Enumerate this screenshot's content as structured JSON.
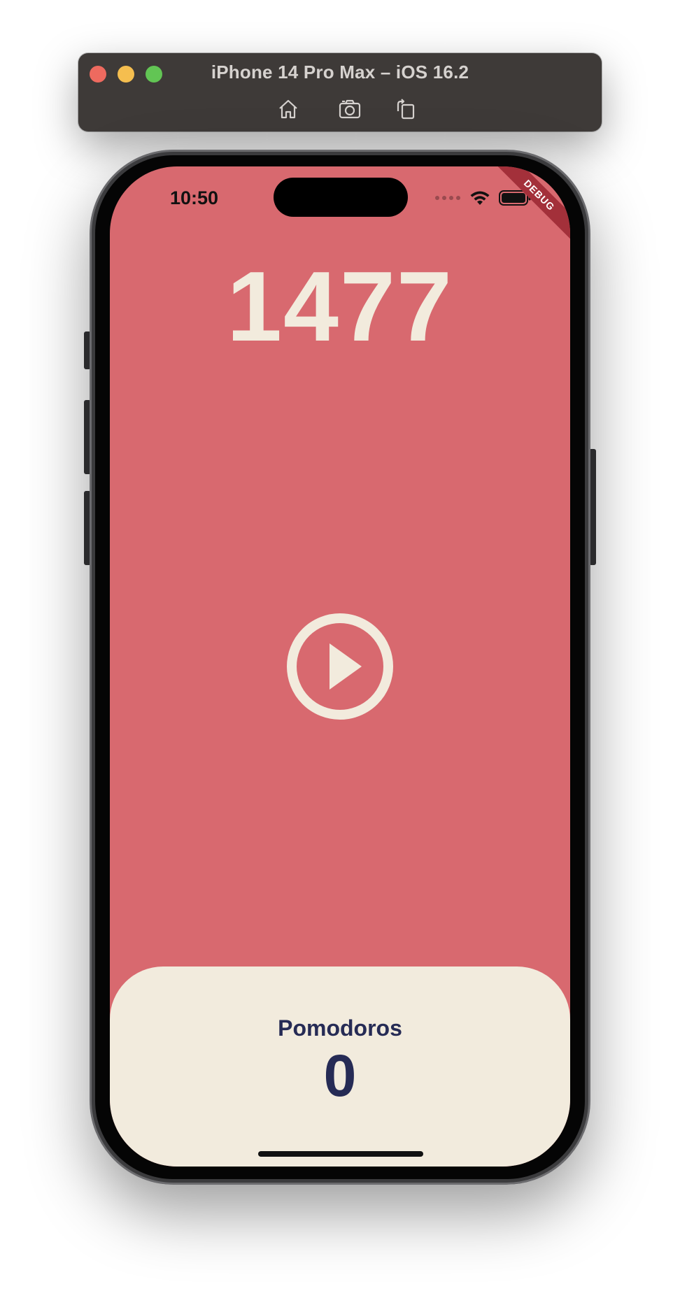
{
  "simulator": {
    "title": "iPhone 14 Pro Max – iOS 16.2",
    "tools": [
      {
        "name": "home",
        "icon": "home-icon"
      },
      {
        "name": "screenshot",
        "icon": "camera-icon"
      },
      {
        "name": "rotate",
        "icon": "rotate-icon"
      }
    ]
  },
  "status_bar": {
    "time": "10:50"
  },
  "debug_banner": {
    "label": "DEBUG"
  },
  "timer": {
    "value": "1477"
  },
  "controls": {
    "play_icon": "play-circle-icon"
  },
  "pomodoros": {
    "label": "Pomodoros",
    "count": "0"
  },
  "colors": {
    "background": "#d8696f",
    "card": "#f2ebdd",
    "accent_text": "#262b55",
    "timer_text": "#f2ebdd",
    "debug_ribbon": "#a3303a"
  }
}
